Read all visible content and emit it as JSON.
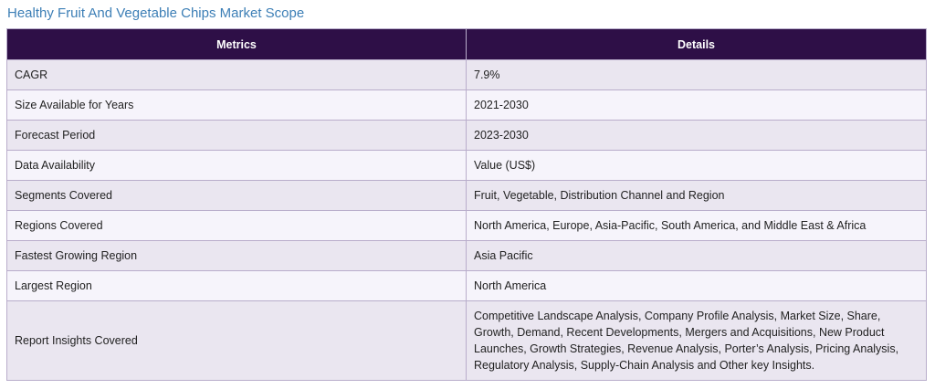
{
  "title": "Healthy Fruit And Vegetable Chips Market Scope",
  "table": {
    "headers": [
      "Metrics",
      "Details"
    ],
    "rows": [
      {
        "metric": "CAGR",
        "detail": "7.9%"
      },
      {
        "metric": "Size Available for Years",
        "detail": "2021-2030"
      },
      {
        "metric": "Forecast Period",
        "detail": "2023-2030"
      },
      {
        "metric": "Data Availability",
        "detail": "Value (US$)"
      },
      {
        "metric": "Segments Covered",
        "detail": "Fruit, Vegetable, Distribution Channel and Region"
      },
      {
        "metric": "Regions Covered",
        "detail": "North America, Europe, Asia-Pacific, South America, and Middle East & Africa"
      },
      {
        "metric": "Fastest Growing Region",
        "detail": "Asia Pacific"
      },
      {
        "metric": "Largest Region",
        "detail": "North America"
      },
      {
        "metric": "Report Insights Covered",
        "detail": "Competitive Landscape Analysis, Company Profile Analysis, Market Size, Share, Growth, Demand, Recent Developments, Mergers and Acquisitions, New Product Launches, Growth Strategies, Revenue Analysis, Porter’s Analysis, Pricing Analysis, Regulatory Analysis, Supply-Chain Analysis and Other key Insights."
      }
    ]
  },
  "colors": {
    "title": "#3d7fb6",
    "header_bg": "#2e0f47",
    "row_odd": "#eae6f0",
    "row_even": "#f6f4fb",
    "border": "#b9adcb"
  }
}
